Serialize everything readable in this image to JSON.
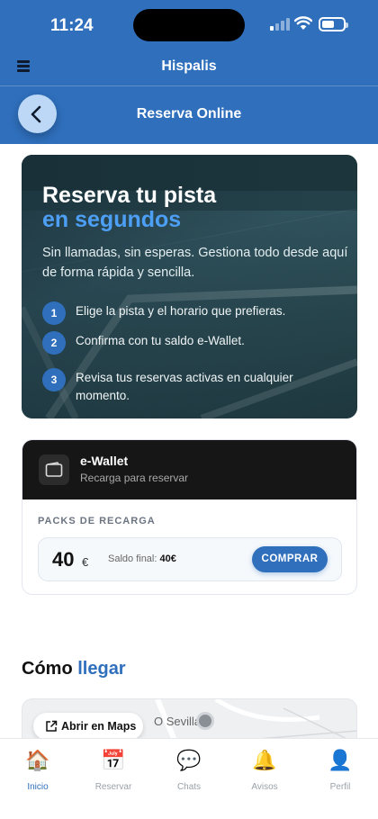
{
  "status_bar": {
    "time": "11:24"
  },
  "header": {
    "app_title": "Hispalis",
    "page_title": "Reserva Online"
  },
  "hero": {
    "title_line1": "Reserva tu pista",
    "title_line2": "en segundos",
    "intro": "Sin llamadas, sin esperas. Gestiona todo desde aquí de forma rápida y sencilla.",
    "steps": [
      {
        "num": "1",
        "text": "Elige la pista y el horario que prefieras."
      },
      {
        "num": "2",
        "text": "Confirma con tu saldo e-Wallet."
      },
      {
        "num": "3",
        "text": "Revisa tus reservas activas en cualquier momento."
      }
    ]
  },
  "wallet": {
    "title": "e-Wallet",
    "subtitle": "Recarga para reservar",
    "packs_label": "PACKS DE RECARGA",
    "pack": {
      "amount": "40",
      "currency": "€",
      "saldo_label": "Saldo final:",
      "saldo_value": "40€",
      "buy_label": "COMPRAR"
    }
  },
  "location": {
    "heading_part1": "Cómo",
    "heading_part2": "llegar",
    "maps_button": "Abrir en Maps",
    "map_label": "O Sevilla"
  },
  "tabbar": {
    "items": [
      {
        "label": "Inicio",
        "icon": "house-icon",
        "active": true
      },
      {
        "label": "Reservar",
        "icon": "calendar-icon",
        "active": false
      },
      {
        "label": "Chats",
        "icon": "speech-bubble-icon",
        "active": false
      },
      {
        "label": "Avisos",
        "icon": "bell-icon",
        "active": false
      },
      {
        "label": "Perfil",
        "icon": "person-icon",
        "active": false
      }
    ]
  },
  "colors": {
    "primary": "#2f6fbc",
    "accent_text": "#4d9ff5",
    "wallet_header": "#161616"
  }
}
